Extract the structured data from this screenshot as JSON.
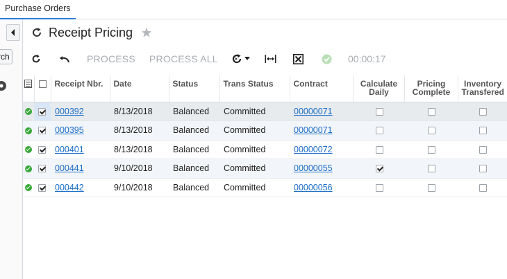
{
  "topbar": {
    "tab_label": "Purchase Orders"
  },
  "sidebar": {
    "search_chip_text": "rch"
  },
  "header": {
    "title": "Receipt Pricing"
  },
  "toolbar": {
    "process_label": "PROCESS",
    "process_all_label": "PROCESS ALL",
    "timer": "00:00:17"
  },
  "grid": {
    "columns": [
      "",
      "",
      "Receipt Nbr.",
      "Date",
      "Status",
      "Trans Status",
      "Contract",
      "Calculate Daily",
      "Pricing Complete",
      "Inventory Transfered"
    ],
    "rows": [
      {
        "receipt": "000392",
        "date": "8/13/2018",
        "status": "Balanced",
        "trans_status": "Committed",
        "contract": "00000071",
        "calc_daily": false,
        "pricing_complete": false,
        "inv_transfered": false
      },
      {
        "receipt": "000395",
        "date": "8/13/2018",
        "status": "Balanced",
        "trans_status": "Committed",
        "contract": "00000071",
        "calc_daily": false,
        "pricing_complete": false,
        "inv_transfered": false
      },
      {
        "receipt": "000401",
        "date": "8/13/2018",
        "status": "Balanced",
        "trans_status": "Committed",
        "contract": "00000072",
        "calc_daily": false,
        "pricing_complete": false,
        "inv_transfered": false
      },
      {
        "receipt": "000441",
        "date": "9/10/2018",
        "status": "Balanced",
        "trans_status": "Committed",
        "contract": "00000055",
        "calc_daily": true,
        "pricing_complete": false,
        "inv_transfered": false
      },
      {
        "receipt": "000442",
        "date": "9/10/2018",
        "status": "Balanced",
        "trans_status": "Committed",
        "contract": "00000056",
        "calc_daily": false,
        "pricing_complete": false,
        "inv_transfered": false
      }
    ]
  },
  "icons": {
    "refresh": "refresh-icon",
    "undo": "undo-icon",
    "star": "star-icon",
    "fit": "fit-columns-icon",
    "excel": "export-excel-icon",
    "check": "check-circle-icon"
  },
  "colors": {
    "link": "#1a6cc8",
    "ok": "#38a838",
    "accent": "#2a7bd4"
  }
}
